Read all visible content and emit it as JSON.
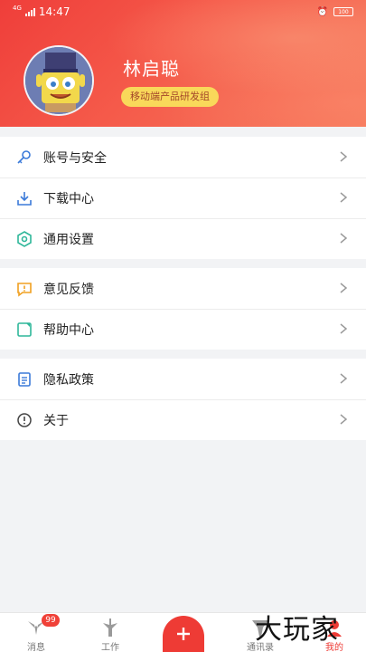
{
  "status_bar": {
    "time": "14:47",
    "network": "4G",
    "battery": "100"
  },
  "profile": {
    "name": "林启聪",
    "department": "移动端产品研发组"
  },
  "menu_groups": [
    {
      "items": [
        {
          "label": "账号与安全",
          "icon": "key-icon"
        },
        {
          "label": "下载中心",
          "icon": "download-icon"
        },
        {
          "label": "通用设置",
          "icon": "settings-hexagon-icon"
        }
      ]
    },
    {
      "items": [
        {
          "label": "意见反馈",
          "icon": "feedback-icon"
        },
        {
          "label": "帮助中心",
          "icon": "help-icon"
        }
      ]
    },
    {
      "items": [
        {
          "label": "隐私政策",
          "icon": "document-icon"
        },
        {
          "label": "关于",
          "icon": "info-icon"
        }
      ]
    }
  ],
  "tabbar": {
    "tabs": [
      {
        "label": "消息",
        "badge": "99",
        "icon": "message-icon"
      },
      {
        "label": "工作",
        "icon": "work-icon"
      },
      {
        "label": "通讯录",
        "icon": "contacts-icon"
      },
      {
        "label": "我的",
        "icon": "me-icon"
      }
    ],
    "add_icon": "plus-icon"
  },
  "watermark": "大玩家",
  "colors": {
    "accent": "#ee3b35",
    "badge_bg": "#f9d85a"
  }
}
